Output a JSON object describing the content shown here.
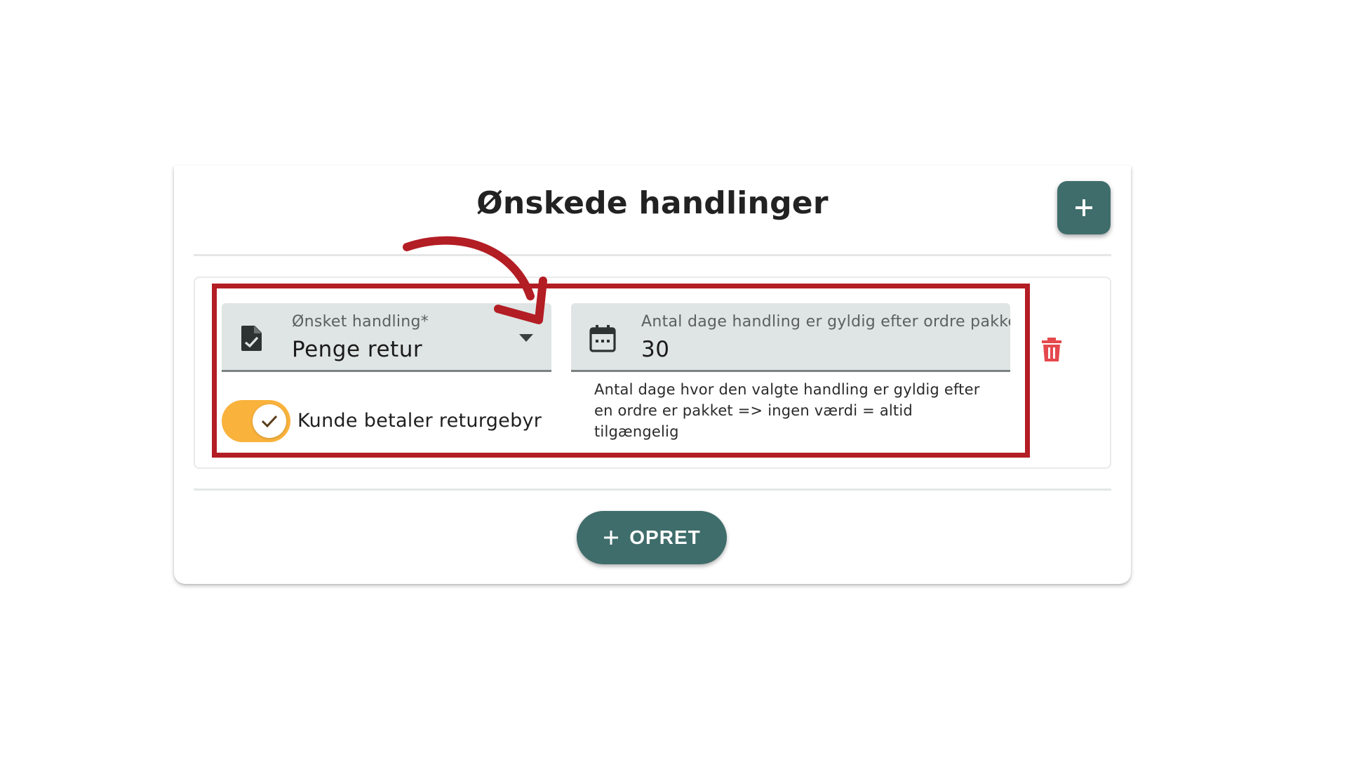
{
  "card": {
    "title": "Ønskede handlinger",
    "add_icon": "plus-icon"
  },
  "action_row": {
    "action_field": {
      "label": "Ønsket handling*",
      "value": "Penge retur",
      "icon": "document-check-icon",
      "dropdown_icon": "caret-down-icon"
    },
    "days_field": {
      "label": "Antal dage handling er gyldig efter ordre pakket",
      "value": "30",
      "icon": "calendar-icon",
      "hint": "Antal dage hvor den valgte handling er gyldig efter en ordre er pakket => ingen værdi = altid tilgængelig"
    },
    "toggle": {
      "label": "Kunde betaler returgebyr",
      "checked": true,
      "color": "#f9b23c"
    },
    "delete_icon": "trash-icon"
  },
  "create_button": {
    "label": "OPRET",
    "icon": "plus-icon"
  },
  "colors": {
    "primary": "#3f6d6b",
    "danger": "#e5484d",
    "annotation": "#b31d24"
  }
}
